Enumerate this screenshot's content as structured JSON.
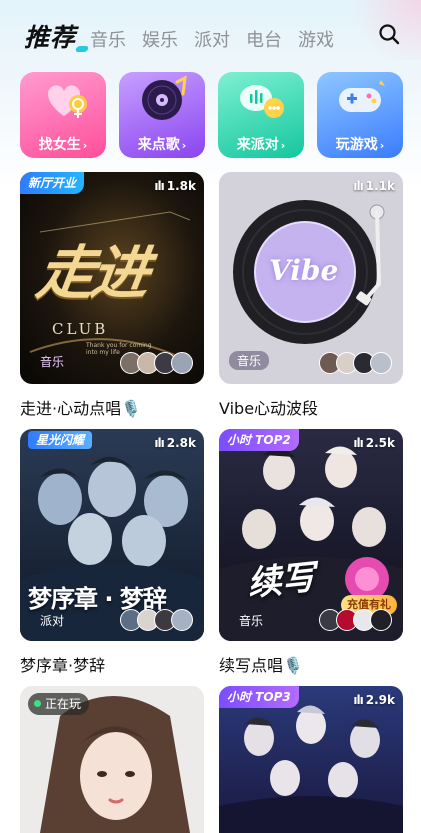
{
  "nav": {
    "active_tab": "推荐",
    "tabs": [
      "音乐",
      "娱乐",
      "派对",
      "电台",
      "游戏"
    ]
  },
  "categories": [
    {
      "label": "找女生",
      "icon": "heart-gender-icon"
    },
    {
      "label": "来点歌",
      "icon": "vinyl-record-icon"
    },
    {
      "label": "来派对",
      "icon": "chat-bubbles-icon"
    },
    {
      "label": "玩游戏",
      "icon": "gamepad-icon"
    }
  ],
  "rooms": [
    {
      "title": "走进·心动点唱🎙️",
      "badge": "新厅开业",
      "count": "1.8k",
      "tag": "音乐",
      "cover_text": "走进",
      "cover_sub": "CLUB",
      "cover_small": "Thank you for coming into my life"
    },
    {
      "title": "Vibe心动波段",
      "badge": "",
      "count": "1.1k",
      "tag": "音乐",
      "cover_text": "Vibe"
    },
    {
      "title": "梦序章·梦辞",
      "badge": "星光闪耀",
      "count": "2.8k",
      "tag": "派对",
      "cover_text": "梦序章 · 梦辞"
    },
    {
      "title": "续写点唱🎙️",
      "badge": "小时 TOP2",
      "count": "2.5k",
      "tag": "音乐",
      "cover_text": "续写",
      "gift": "充值有礼"
    },
    {
      "title": "",
      "badge": "",
      "count": "",
      "tag": "",
      "status": "正在玩"
    },
    {
      "title": "",
      "badge": "小时 TOP3",
      "count": "2.9k",
      "tag": ""
    }
  ],
  "colors": {
    "accent": "#28c8e0",
    "tab_inactive": "#8f9398",
    "badge_blue": "#2f7bff",
    "badge_purple": "#7a4dff",
    "online_green": "#3ee07a"
  }
}
